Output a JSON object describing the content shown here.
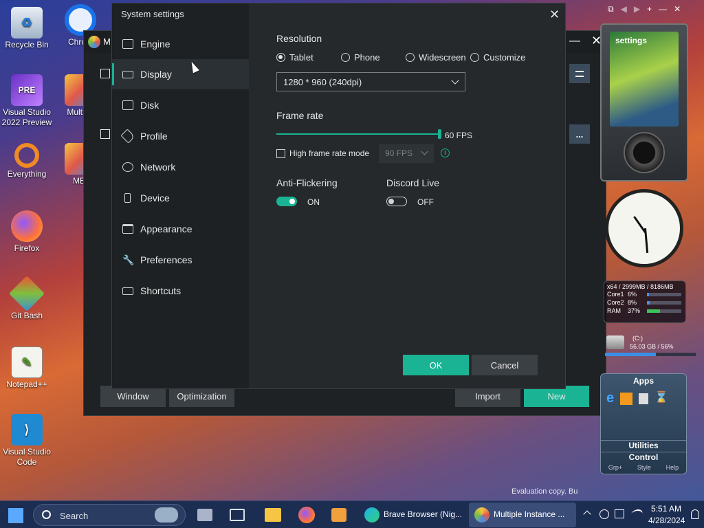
{
  "desktop": {
    "icons": [
      {
        "label": "Recycle Bin"
      },
      {
        "label": "Chrom"
      },
      {
        "label": "Visual Studio 2022 Preview",
        "badge": "PRE"
      },
      {
        "label": "Multi-M"
      },
      {
        "label": "Everything"
      },
      {
        "label": "MEr"
      },
      {
        "label": "Firefox"
      },
      {
        "label": "Git Bash"
      },
      {
        "label": "Notepad++"
      },
      {
        "label": "Visual Studio Code"
      }
    ],
    "watermark": "Evaluation copy. Bu"
  },
  "back_window": {
    "title_initial": "M",
    "bottom_buttons": {
      "window": "Window",
      "optimization": "Optimization",
      "import": "Import",
      "new": "New"
    },
    "menu_icon": "hamburger-icon",
    "more_label": "..."
  },
  "dialog": {
    "title": "System settings",
    "nav": [
      {
        "label": "Engine",
        "icon": "chip-icon"
      },
      {
        "label": "Display",
        "icon": "monitor-icon"
      },
      {
        "label": "Disk",
        "icon": "disk-icon"
      },
      {
        "label": "Profile",
        "icon": "tag-icon"
      },
      {
        "label": "Network",
        "icon": "globe-icon"
      },
      {
        "label": "Device",
        "icon": "phone-icon"
      },
      {
        "label": "Appearance",
        "icon": "window-icon"
      },
      {
        "label": "Preferences",
        "icon": "wrench-icon"
      },
      {
        "label": "Shortcuts",
        "icon": "keyboard-icon"
      }
    ],
    "active_nav": "Display",
    "resolution": {
      "heading": "Resolution",
      "options": [
        "Tablet",
        "Phone",
        "Widescreen",
        "Customize"
      ],
      "selected": "Tablet",
      "value": "1280 * 960 (240dpi)"
    },
    "frame_rate": {
      "heading": "Frame rate",
      "value_label": "60 FPS",
      "level": 1.0,
      "high_mode_label": "High frame rate mode",
      "high_mode_checked": false,
      "high_mode_value": "90 FPS"
    },
    "anti_flickering": {
      "label": "Anti-Flickering",
      "state": "ON"
    },
    "discord_live": {
      "label": "Discord Live",
      "state": "OFF"
    },
    "ok": "OK",
    "cancel": "Cancel",
    "accent": "#1ab394"
  },
  "gadgets": {
    "player_title": "settings",
    "cpu_header": "x64 / 2999MB / 8186MB",
    "cpu_rows": [
      {
        "name": "Core1",
        "value": "6%",
        "level": 0.06
      },
      {
        "name": "Core2",
        "value": "8%",
        "level": 0.08
      },
      {
        "name": "RAM",
        "value": "37%",
        "level": 0.37
      }
    ],
    "drive_label": "(C:)",
    "drive_info": "56.03 GB / 56%",
    "drive_level": 0.56,
    "apps_title": "Apps",
    "utilities": "Utilities",
    "control": "Control",
    "footer": [
      "Grp+",
      "Style",
      "Help"
    ]
  },
  "taskbar": {
    "search_placeholder": "Search",
    "brave": "Brave Browser (Nig...",
    "multi": "Multiple Instance ...",
    "time": "5:51 AM",
    "date": "4/28/2024"
  }
}
